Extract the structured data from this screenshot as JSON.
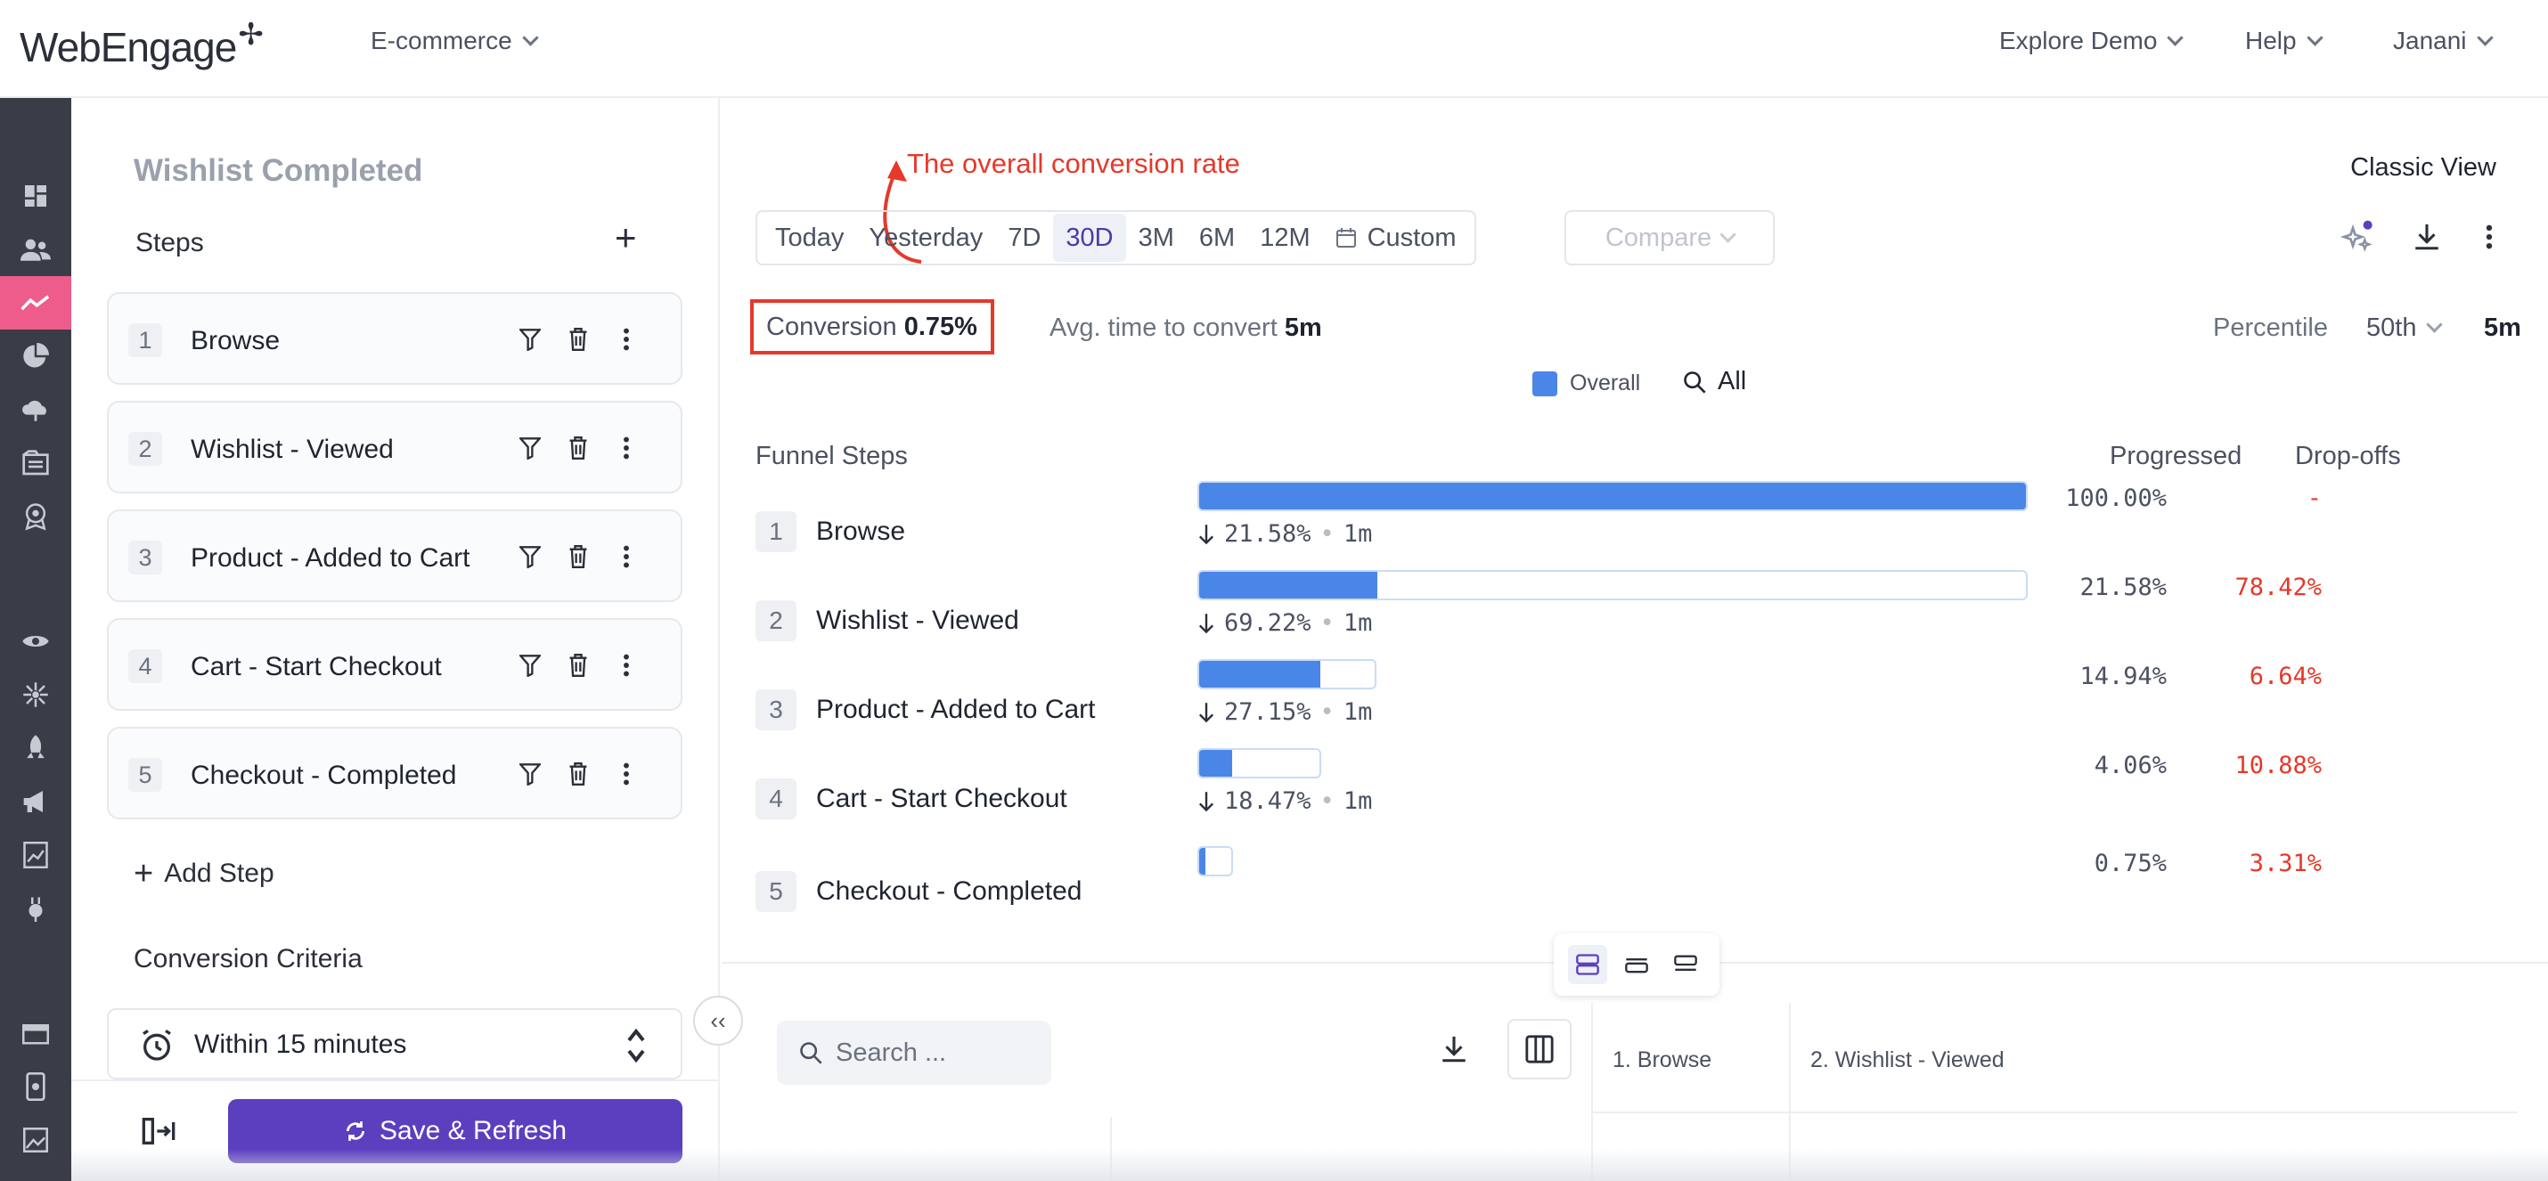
{
  "header": {
    "logo_text": "WebEngage",
    "project": "E-commerce",
    "explore_demo": "Explore Demo",
    "help": "Help",
    "user": "Janani"
  },
  "leftnav": {
    "icons": [
      "dashboard-icon",
      "users-icon",
      "analytics-icon",
      "pie-chart-icon",
      "cloud-icon",
      "catalog-icon",
      "badge-icon",
      "eye-icon",
      "hub-icon",
      "rocket-icon",
      "megaphone-icon",
      "report-icon",
      "plug-icon",
      "inbox-icon",
      "mobile-icon",
      "image-icon"
    ],
    "active": "analytics-icon"
  },
  "panel": {
    "title": "Wishlist Completed",
    "steps_label": "Steps",
    "steps": [
      {
        "num": "1",
        "name": "Browse"
      },
      {
        "num": "2",
        "name": "Wishlist - Viewed"
      },
      {
        "num": "3",
        "name": "Product - Added to Cart"
      },
      {
        "num": "4",
        "name": "Cart - Start Checkout"
      },
      {
        "num": "5",
        "name": "Checkout - Completed"
      }
    ],
    "add_step": "Add Step",
    "criteria_label": "Conversion Criteria",
    "criteria_value": "Within 15 minutes",
    "save_label": "Save & Refresh"
  },
  "main": {
    "classic_view": "Classic View",
    "annotation": "The overall conversion rate",
    "date_options": [
      "Today",
      "Yesterday",
      "7D",
      "30D",
      "3M",
      "6M",
      "12M",
      "Custom"
    ],
    "active_date": "30D",
    "compare": "Compare",
    "conversion_label": "Conversion",
    "conversion_value": "0.75%",
    "avg_time_label": "Avg. time to convert",
    "avg_time_value": "5m",
    "percentile_label": "Percentile",
    "percentile_value": "50th",
    "percentile_time": "5m",
    "legend_overall": "Overall",
    "legend_all": "All",
    "funnel_head": "Funnel Steps",
    "col_progressed": "Progressed",
    "col_dropoffs": "Drop-offs",
    "search_placeholder": "Search ...",
    "table_col1": "1. Browse",
    "table_col2": "2. Wishlist - Viewed"
  },
  "chart_data": {
    "type": "bar",
    "categories": [
      "Browse",
      "Wishlist - Viewed",
      "Product - Added to Cart",
      "Cart - Start Checkout",
      "Checkout - Completed"
    ],
    "progressed": [
      "100.00%",
      "21.58%",
      "14.94%",
      "4.06%",
      "0.75%"
    ],
    "dropoffs": [
      "-",
      "78.42%",
      "6.64%",
      "10.88%",
      "3.31%"
    ],
    "step_drop": [
      "21.58%",
      "69.22%",
      "27.15%",
      "18.47%",
      ""
    ],
    "step_time": [
      "1m",
      "1m",
      "1m",
      "1m",
      ""
    ],
    "values": [
      100,
      21.58,
      14.94,
      4.06,
      0.75
    ],
    "bar_track_scale": [
      100,
      100,
      21.58,
      14.94,
      4.06
    ],
    "colors": {
      "bar": "#4a86e8",
      "drop": "#e5392a"
    }
  }
}
